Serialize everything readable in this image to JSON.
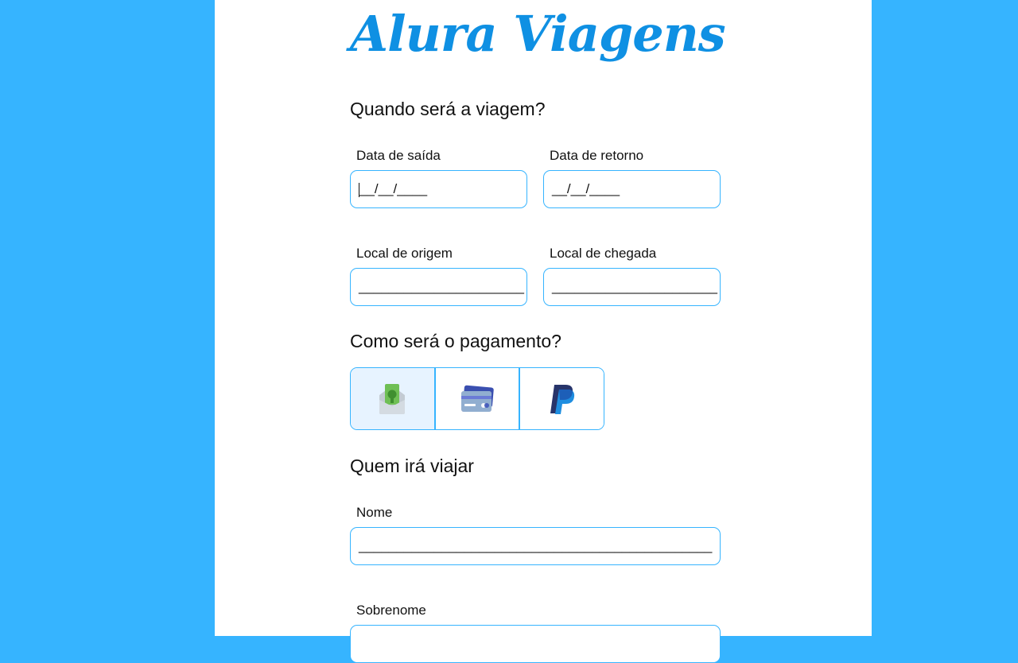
{
  "brand": {
    "title": "Alura Viagens"
  },
  "sections": {
    "trip": "Quando será a viagem?",
    "payment": "Como será o pagamento?",
    "travelers": "Quem irá viajar"
  },
  "trip_fields": {
    "departure": {
      "label": "Data de saída",
      "value": "__/__/____"
    },
    "return": {
      "label": "Data de retorno",
      "value": "__/__/____"
    },
    "origin": {
      "label": "Local de origem",
      "value": "______________________"
    },
    "destination": {
      "label": "Local de chegada",
      "value": "______________________"
    }
  },
  "payment": {
    "options": [
      {
        "icon": "cash-envelope-icon",
        "selected": true
      },
      {
        "icon": "credit-card-icon",
        "selected": false
      },
      {
        "icon": "paypal-icon",
        "selected": false
      }
    ]
  },
  "traveler_fields": {
    "first_name": {
      "label": "Nome",
      "value": "_______________________________________________"
    },
    "last_name": {
      "label": "Sobrenome",
      "value": ""
    }
  },
  "colors": {
    "background": "#36b4ff",
    "brand": "#0f90e3",
    "border": "#36b4ff",
    "selected": "#e7f3ff"
  }
}
